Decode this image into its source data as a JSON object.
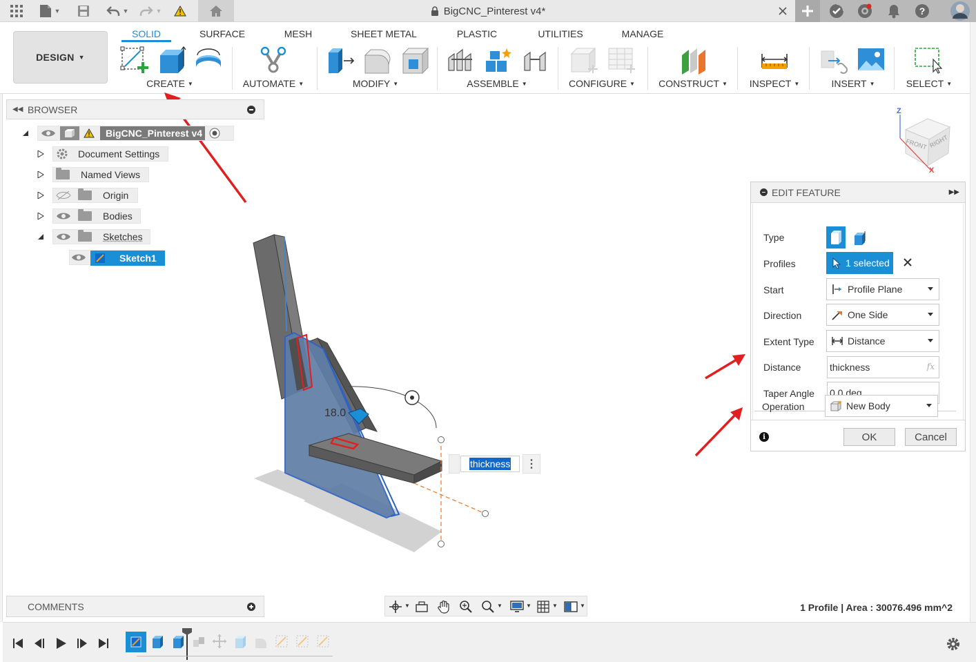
{
  "titlebar": {
    "document_title": "BigCNC_Pinterest v4*",
    "icons": [
      "apps-grid-icon",
      "file-icon",
      "save-icon",
      "undo-icon",
      "redo-icon",
      "warning-icon",
      "home-icon",
      "lock-icon",
      "close-icon",
      "plus-icon",
      "job-status-icon",
      "extensions-icon",
      "notifications-icon",
      "help-icon",
      "user-avatar"
    ]
  },
  "ribbon": {
    "workspace": "DESIGN",
    "tabs": [
      "SOLID",
      "SURFACE",
      "MESH",
      "SHEET METAL",
      "PLASTIC",
      "UTILITIES",
      "MANAGE"
    ],
    "active_tab": "SOLID",
    "groups": [
      "CREATE",
      "AUTOMATE",
      "MODIFY",
      "ASSEMBLE",
      "CONFIGURE",
      "CONSTRUCT",
      "INSPECT",
      "INSERT",
      "SELECT"
    ]
  },
  "browser": {
    "title": "BROWSER",
    "root": "BigCNC_Pinterest v4",
    "items": [
      "Document Settings",
      "Named Views",
      "Origin",
      "Bodies",
      "Sketches"
    ],
    "sketch": "Sketch1"
  },
  "viewport": {
    "dimension_input": "thickness",
    "dimension_label": "18.0",
    "viewcube": {
      "front": "FRONT",
      "right": "RIGHT",
      "z": "Z",
      "x": "X"
    }
  },
  "edit_feature": {
    "title": "EDIT FEATURE",
    "labels": {
      "type": "Type",
      "profiles": "Profiles",
      "start": "Start",
      "direction": "Direction",
      "extent_type": "Extent Type",
      "distance": "Distance",
      "taper_angle": "Taper Angle",
      "operation": "Operation"
    },
    "values": {
      "profiles": "1 selected",
      "start": "Profile Plane",
      "direction": "One Side",
      "extent_type": "Distance",
      "distance": "thickness",
      "distance_fx": "fx",
      "taper_angle": "0.0 deg",
      "operation": "New Body"
    },
    "ok": "OK",
    "cancel": "Cancel"
  },
  "comments": {
    "title": "COMMENTS"
  },
  "status": {
    "text": "1 Profile | Area : 30076.496 mm^2"
  },
  "colors": {
    "accent": "#1a8fd6",
    "annotation_arrow": "#e02020",
    "selected_highlight": "#1268c9"
  }
}
